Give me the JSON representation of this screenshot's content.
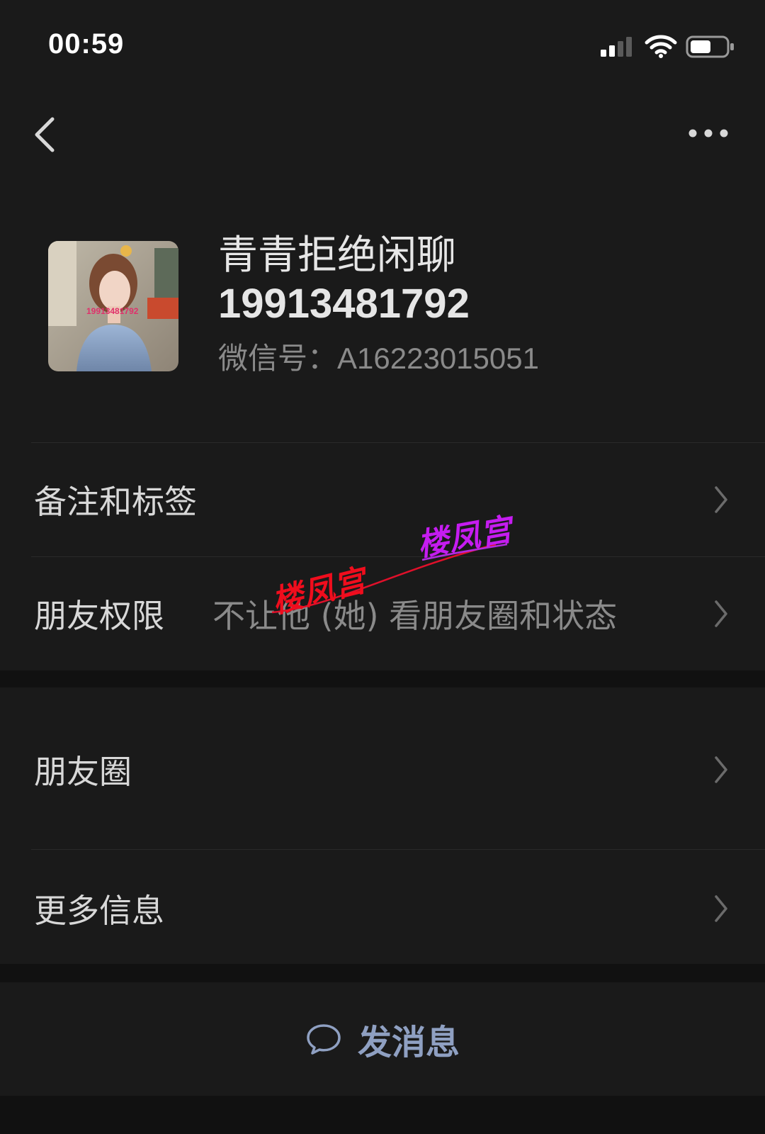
{
  "status_bar": {
    "time": "00:59"
  },
  "profile": {
    "name": "青青拒绝闲聊",
    "phone": "19913481792",
    "wechat_id_label": "微信号：",
    "wechat_id": "A16223015051",
    "avatar_text": "19913481792"
  },
  "rows": {
    "remarks": {
      "label": "备注和标签"
    },
    "permissions": {
      "label": "朋友权限",
      "value": "不让他 (她) 看朋友圈和状态"
    },
    "moments": {
      "label": "朋友圈"
    },
    "more_info": {
      "label": "更多信息"
    }
  },
  "actions": {
    "send_message": "发消息"
  },
  "watermark": {
    "text_1": "楼凤宫",
    "text_2": "楼凤宫"
  },
  "colors": {
    "background": "#111111",
    "cell": "#1a1a1a",
    "send_accent": "#8fa0c2"
  }
}
